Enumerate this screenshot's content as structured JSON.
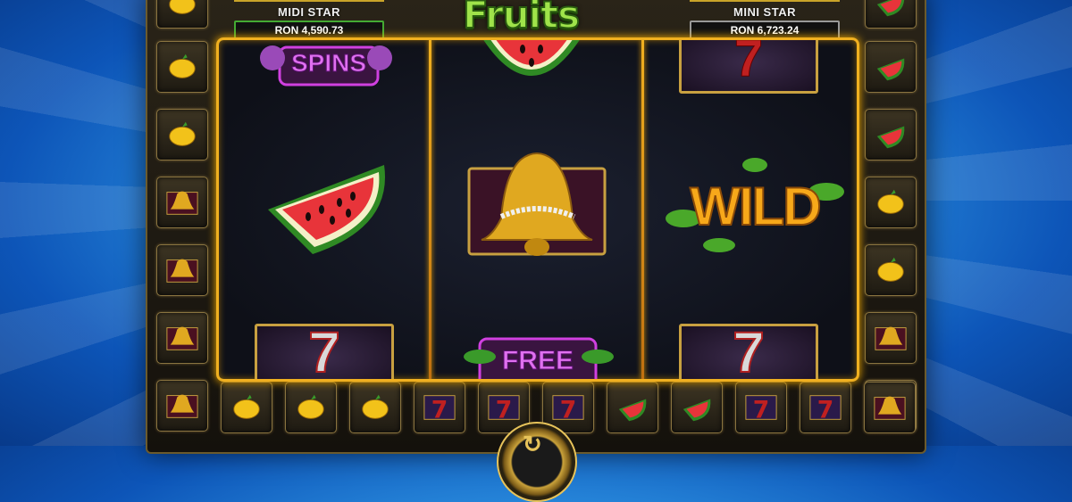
{
  "jackpots": {
    "midi": {
      "name": "MIDI STAR",
      "amount": "RON 4,590.73"
    },
    "mini": {
      "name": "MINI STAR",
      "amount": "RON 6,723.24"
    }
  },
  "logo": {
    "text": "Fruits"
  },
  "reels": {
    "reel1": [
      "free-spins-symbol",
      "watermelon-symbol",
      "seven-symbol"
    ],
    "reel2": [
      "watermelon-symbol",
      "bell-symbol",
      "free-spins-symbol"
    ],
    "reel3": [
      "seven-symbol",
      "wild-symbol",
      "seven-symbol"
    ]
  },
  "symbol_text": {
    "free": "FREE",
    "spins": "SPINS",
    "wild": "WILD",
    "seven": "7",
    "free_partial": "FREE"
  },
  "colors": {
    "accent": "#f0b020",
    "frame": "#6b5a2c",
    "background": "#2b8fe0"
  }
}
